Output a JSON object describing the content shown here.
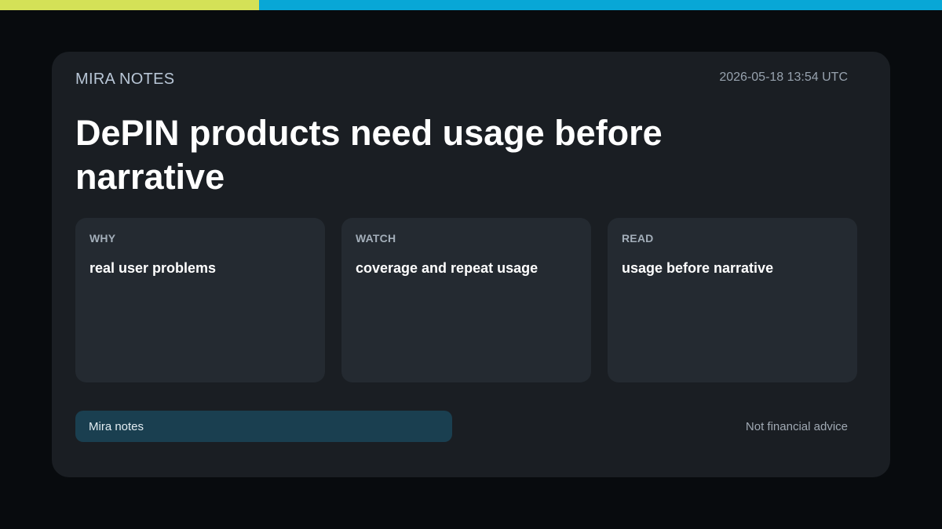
{
  "colors": {
    "accent_lime": "#d4e157",
    "accent_cyan": "#08a7d6",
    "page_bg": "#080b0e",
    "card_bg": "#1a1e23",
    "panel_bg": "#242a31",
    "pill_bg": "#1a3f50"
  },
  "header": {
    "brand": "MIRA NOTES",
    "timestamp": "2026-05-18 13:54 UTC"
  },
  "headline": "DePIN products need usage before narrative",
  "panels": [
    {
      "label": "WHY",
      "text": "real user problems"
    },
    {
      "label": "WATCH",
      "text": "coverage and repeat usage"
    },
    {
      "label": "READ",
      "text": "usage before narrative"
    }
  ],
  "footer": {
    "pill_label": "Mira notes",
    "disclaimer": "Not financial advice"
  }
}
